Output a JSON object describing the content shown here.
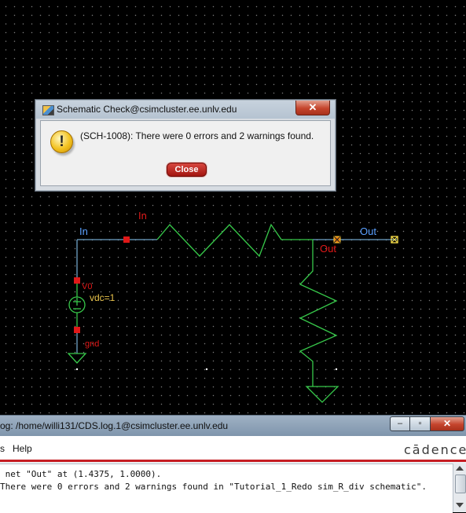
{
  "schematic": {
    "wire_label_in_top": "In",
    "pin_label_in": "In",
    "pin_label_out": "Out",
    "net_label_out": "Out",
    "source_instance": "V0",
    "source_param": "vdc=1",
    "ground_label": "gnd",
    "colors": {
      "wire": "#6fa3c8",
      "device": "#37c94a",
      "label_red": "#e01818",
      "pin_blue": "#5aa0ff"
    }
  },
  "dialog": {
    "title": "Schematic Check@csimcluster.ee.unlv.edu",
    "close_glyph": "✕",
    "message": "(SCH-1008): There were 0 errors and 2 warnings found.",
    "close_label": "Close",
    "icon": "warning-icon"
  },
  "ciw": {
    "title": "og: /home/willi131/CDS.log.1@csimcluster.ee.unlv.edu",
    "menu_partial": "s",
    "menu_help": "Help",
    "logo": "cādence",
    "output_lines": [
      " net \"Out\" at (1.4375, 1.0000).",
      "There were 0 errors and 2 warnings found in \"Tutorial_1_Redo sim_R_div schematic\"."
    ],
    "window_buttons": {
      "minimize": "–",
      "maximize": "▫",
      "close": "✕"
    }
  }
}
